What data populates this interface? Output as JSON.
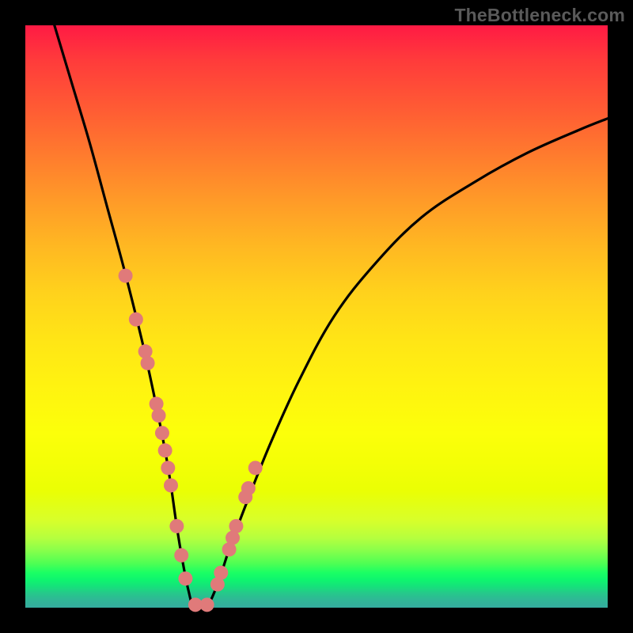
{
  "watermark": "TheBottleneck.com",
  "chart_data": {
    "type": "line",
    "title": "",
    "xlabel": "",
    "ylabel": "",
    "xlim": [
      0,
      100
    ],
    "ylim": [
      0,
      100
    ],
    "grid": false,
    "series": [
      {
        "name": "bottleneck-curve",
        "x": [
          5,
          8,
          11,
          14,
          17,
          20,
          22,
          24,
          25,
          26,
          27,
          28,
          29,
          31,
          33,
          35,
          38,
          42,
          47,
          53,
          60,
          68,
          77,
          86,
          95,
          100
        ],
        "values": [
          100,
          90,
          80,
          69,
          58,
          46,
          37,
          27,
          21,
          14,
          8,
          3,
          0,
          0,
          4,
          10,
          18,
          28,
          39,
          50,
          59,
          67,
          73,
          78,
          82,
          84
        ]
      }
    ],
    "markers": {
      "name": "highlight-dots",
      "color": "#e07a7a",
      "x": [
        17.2,
        19.0,
        20.6,
        21.0,
        22.5,
        22.9,
        23.5,
        24.0,
        24.5,
        25.0,
        26.0,
        26.8,
        27.5,
        29.2,
        31.2,
        33.0,
        33.6,
        35.0,
        35.6,
        36.2,
        37.8,
        38.3,
        39.5
      ],
      "values": [
        57.0,
        49.5,
        44.0,
        42.0,
        35.0,
        33.0,
        30.0,
        27.0,
        24.0,
        21.0,
        14.0,
        9.0,
        5.0,
        0.5,
        0.5,
        4.0,
        6.0,
        10.0,
        12.0,
        14.0,
        19.0,
        20.5,
        24.0
      ]
    },
    "curve_dip_x": 30
  }
}
